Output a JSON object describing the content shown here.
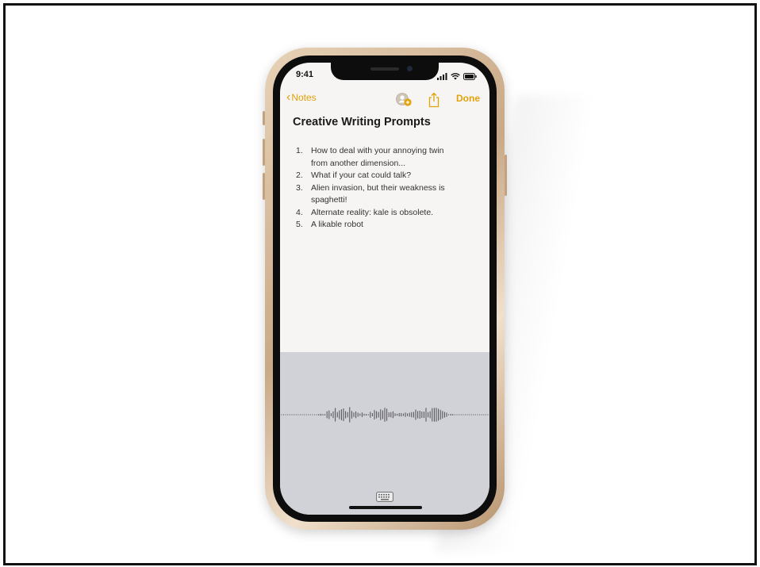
{
  "status_bar": {
    "time": "9:41",
    "icons": [
      "cellular-signal-icon",
      "wifi-icon",
      "battery-icon"
    ]
  },
  "nav": {
    "back_label": "Notes",
    "collaborate_icon": "add-person-icon",
    "share_icon": "share-icon",
    "done_label": "Done"
  },
  "note": {
    "title": "Creative Writing Prompts",
    "items": [
      {
        "num": "1.",
        "lines": [
          "How to deal with your annoying twin",
          "from another dimension..."
        ]
      },
      {
        "num": "2.",
        "lines": [
          "What if your cat could talk?"
        ]
      },
      {
        "num": "3.",
        "lines": [
          "Alien invasion, but their weakness is",
          "spaghetti!"
        ]
      },
      {
        "num": "4.",
        "lines": [
          "Alternate reality: kale is obsolete."
        ]
      },
      {
        "num": "5.",
        "lines": [
          "A likable robot"
        ]
      }
    ]
  },
  "dictation": {
    "keyboard_icon": "keyboard-icon"
  },
  "colors": {
    "accent": "#e2a20a",
    "dictation_bg": "#d1d2d8",
    "note_bg": "#f6f5f3",
    "phone_frame": "#c9a987"
  }
}
